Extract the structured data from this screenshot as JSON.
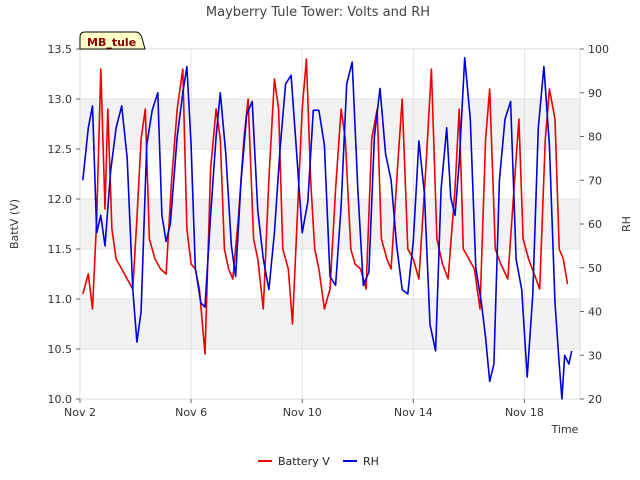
{
  "chart_data": {
    "type": "line",
    "title": "Mayberry Tule Tower: Volts and RH",
    "site_label": "MB_tule",
    "xlabel": "Time",
    "ylabel_left": "BattV (V)",
    "ylabel_right": "RH",
    "x_tick_labels": [
      "Nov 2",
      "Nov 6",
      "Nov 10",
      "Nov 14",
      "Nov 18"
    ],
    "x_tick_days": [
      2,
      6,
      10,
      14,
      18
    ],
    "xlim_days": [
      2,
      20
    ],
    "ylim_left": [
      10.0,
      13.5
    ],
    "ylim_right": [
      20,
      100
    ],
    "yticks_left": [
      "10.0",
      "10.5",
      "11.0",
      "11.5",
      "12.0",
      "12.5",
      "13.0",
      "13.5"
    ],
    "yticks_right": [
      "20",
      "30",
      "40",
      "50",
      "60",
      "70",
      "80",
      "90",
      "100"
    ],
    "grid": true,
    "legend_position": "bottom",
    "series": [
      {
        "name": "Battery V",
        "color": "#ee0000",
        "axis": "left",
        "points": [
          [
            2.1,
            11.05
          ],
          [
            2.3,
            11.25
          ],
          [
            2.45,
            10.9
          ],
          [
            2.6,
            11.8
          ],
          [
            2.75,
            13.3
          ],
          [
            2.9,
            11.9
          ],
          [
            3.0,
            12.9
          ],
          [
            3.15,
            11.7
          ],
          [
            3.3,
            11.4
          ],
          [
            3.5,
            11.3
          ],
          [
            3.7,
            11.2
          ],
          [
            3.9,
            11.1
          ],
          [
            4.05,
            11.8
          ],
          [
            4.2,
            12.6
          ],
          [
            4.35,
            12.9
          ],
          [
            4.5,
            11.6
          ],
          [
            4.7,
            11.4
          ],
          [
            4.9,
            11.3
          ],
          [
            5.1,
            11.25
          ],
          [
            5.3,
            12.2
          ],
          [
            5.5,
            12.9
          ],
          [
            5.7,
            13.3
          ],
          [
            5.85,
            11.7
          ],
          [
            6.0,
            11.35
          ],
          [
            6.15,
            11.3
          ],
          [
            6.3,
            11.1
          ],
          [
            6.5,
            10.45
          ],
          [
            6.7,
            12.3
          ],
          [
            6.9,
            12.9
          ],
          [
            7.05,
            12.6
          ],
          [
            7.2,
            11.5
          ],
          [
            7.35,
            11.3
          ],
          [
            7.5,
            11.2
          ],
          [
            7.7,
            11.8
          ],
          [
            7.9,
            12.6
          ],
          [
            8.05,
            13.0
          ],
          [
            8.25,
            11.6
          ],
          [
            8.4,
            11.4
          ],
          [
            8.6,
            10.9
          ],
          [
            8.8,
            12.2
          ],
          [
            9.0,
            13.2
          ],
          [
            9.15,
            12.9
          ],
          [
            9.3,
            11.5
          ],
          [
            9.5,
            11.3
          ],
          [
            9.65,
            10.75
          ],
          [
            9.85,
            12.0
          ],
          [
            10.0,
            12.9
          ],
          [
            10.15,
            13.4
          ],
          [
            10.3,
            12.2
          ],
          [
            10.45,
            11.5
          ],
          [
            10.6,
            11.3
          ],
          [
            10.8,
            10.9
          ],
          [
            11.0,
            11.1
          ],
          [
            11.2,
            12.1
          ],
          [
            11.4,
            12.9
          ],
          [
            11.55,
            12.6
          ],
          [
            11.75,
            11.5
          ],
          [
            11.9,
            11.35
          ],
          [
            12.1,
            11.3
          ],
          [
            12.3,
            11.1
          ],
          [
            12.5,
            12.6
          ],
          [
            12.7,
            12.9
          ],
          [
            12.85,
            11.6
          ],
          [
            13.05,
            11.4
          ],
          [
            13.2,
            11.3
          ],
          [
            13.45,
            12.4
          ],
          [
            13.6,
            13.0
          ],
          [
            13.8,
            11.5
          ],
          [
            14.0,
            11.4
          ],
          [
            14.2,
            11.2
          ],
          [
            14.45,
            12.3
          ],
          [
            14.65,
            13.3
          ],
          [
            14.85,
            11.6
          ],
          [
            15.05,
            11.35
          ],
          [
            15.25,
            11.2
          ],
          [
            15.5,
            12.1
          ],
          [
            15.65,
            12.9
          ],
          [
            15.8,
            11.5
          ],
          [
            16.0,
            11.4
          ],
          [
            16.2,
            11.3
          ],
          [
            16.4,
            10.9
          ],
          [
            16.6,
            12.6
          ],
          [
            16.75,
            13.1
          ],
          [
            16.95,
            11.5
          ],
          [
            17.15,
            11.35
          ],
          [
            17.4,
            11.2
          ],
          [
            17.6,
            12.0
          ],
          [
            17.8,
            12.8
          ],
          [
            17.95,
            11.6
          ],
          [
            18.15,
            11.4
          ],
          [
            18.35,
            11.25
          ],
          [
            18.55,
            11.1
          ],
          [
            18.75,
            12.6
          ],
          [
            18.9,
            13.1
          ],
          [
            19.1,
            12.8
          ],
          [
            19.25,
            11.5
          ],
          [
            19.4,
            11.4
          ],
          [
            19.55,
            11.15
          ]
        ]
      },
      {
        "name": "RH",
        "color": "#0000dd",
        "axis": "right",
        "points": [
          [
            2.1,
            70
          ],
          [
            2.3,
            82
          ],
          [
            2.45,
            87
          ],
          [
            2.6,
            58
          ],
          [
            2.75,
            62
          ],
          [
            2.9,
            55
          ],
          [
            3.1,
            72
          ],
          [
            3.3,
            82
          ],
          [
            3.5,
            87
          ],
          [
            3.7,
            75
          ],
          [
            3.9,
            45
          ],
          [
            4.05,
            33
          ],
          [
            4.2,
            40
          ],
          [
            4.4,
            78
          ],
          [
            4.6,
            86
          ],
          [
            4.8,
            90
          ],
          [
            4.95,
            62
          ],
          [
            5.1,
            56
          ],
          [
            5.25,
            60
          ],
          [
            5.5,
            80
          ],
          [
            5.7,
            90
          ],
          [
            5.85,
            96
          ],
          [
            6.0,
            78
          ],
          [
            6.15,
            50
          ],
          [
            6.35,
            42
          ],
          [
            6.5,
            41
          ],
          [
            6.7,
            62
          ],
          [
            6.9,
            80
          ],
          [
            7.05,
            90
          ],
          [
            7.25,
            76
          ],
          [
            7.45,
            55
          ],
          [
            7.6,
            48
          ],
          [
            7.8,
            70
          ],
          [
            8.0,
            85
          ],
          [
            8.2,
            88
          ],
          [
            8.4,
            63
          ],
          [
            8.6,
            52
          ],
          [
            8.8,
            45
          ],
          [
            9.0,
            58
          ],
          [
            9.2,
            77
          ],
          [
            9.4,
            92
          ],
          [
            9.6,
            94
          ],
          [
            9.8,
            76
          ],
          [
            10.0,
            58
          ],
          [
            10.2,
            65
          ],
          [
            10.4,
            86
          ],
          [
            10.6,
            86
          ],
          [
            10.8,
            78
          ],
          [
            11.0,
            48
          ],
          [
            11.2,
            46
          ],
          [
            11.4,
            64
          ],
          [
            11.6,
            92
          ],
          [
            11.8,
            97
          ],
          [
            12.0,
            68
          ],
          [
            12.2,
            46
          ],
          [
            12.4,
            49
          ],
          [
            12.6,
            80
          ],
          [
            12.8,
            91
          ],
          [
            13.0,
            76
          ],
          [
            13.2,
            70
          ],
          [
            13.4,
            55
          ],
          [
            13.6,
            45
          ],
          [
            13.8,
            44
          ],
          [
            14.0,
            56
          ],
          [
            14.2,
            79
          ],
          [
            14.4,
            67
          ],
          [
            14.6,
            37
          ],
          [
            14.8,
            31
          ],
          [
            15.0,
            68
          ],
          [
            15.2,
            82
          ],
          [
            15.35,
            66
          ],
          [
            15.5,
            62
          ],
          [
            15.65,
            74
          ],
          [
            15.85,
            98
          ],
          [
            16.05,
            84
          ],
          [
            16.25,
            50
          ],
          [
            16.45,
            42
          ],
          [
            16.6,
            34
          ],
          [
            16.75,
            24
          ],
          [
            16.9,
            28
          ],
          [
            17.1,
            70
          ],
          [
            17.3,
            84
          ],
          [
            17.5,
            88
          ],
          [
            17.7,
            52
          ],
          [
            17.9,
            45
          ],
          [
            18.1,
            25
          ],
          [
            18.3,
            44
          ],
          [
            18.5,
            82
          ],
          [
            18.7,
            96
          ],
          [
            18.9,
            78
          ],
          [
            19.1,
            42
          ],
          [
            19.25,
            28
          ],
          [
            19.35,
            20
          ],
          [
            19.45,
            30
          ],
          [
            19.6,
            28
          ],
          [
            19.7,
            31
          ]
        ]
      }
    ]
  }
}
